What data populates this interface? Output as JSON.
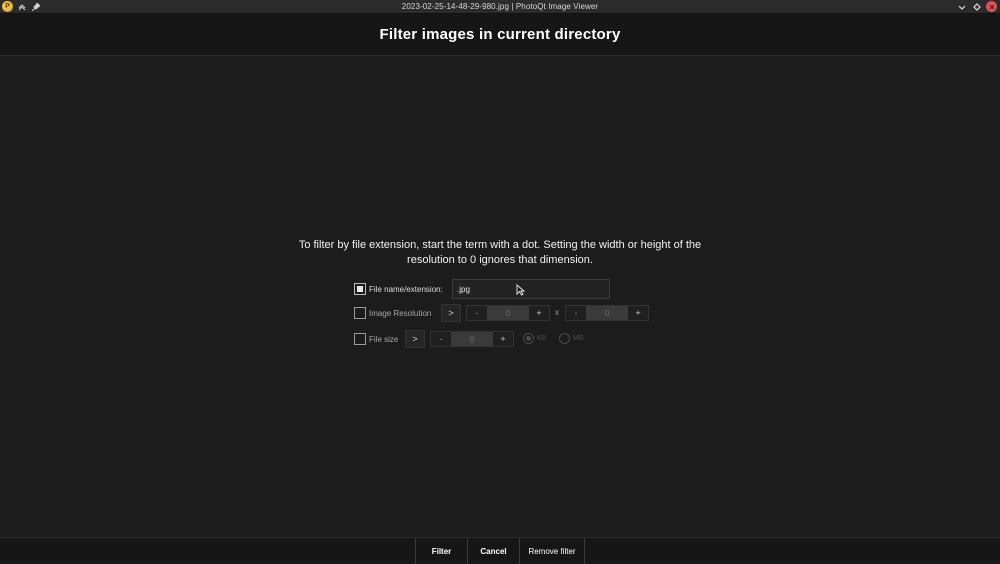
{
  "window": {
    "title": "2023-02-25-14-48-29-980.jpg | PhotoQt Image Viewer",
    "app_icon": "photoqt-app-icon"
  },
  "dialog": {
    "title": "Filter images in current directory",
    "info": "To filter by file extension, start the term with a dot. Setting the width or height of the resolution to 0 ignores that dimension.",
    "filename": {
      "checked": true,
      "label": "File name/extension:",
      "value": ".jpg"
    },
    "resolution": {
      "checked": false,
      "label": "Image Resolution",
      "comparator": ">",
      "width": "0",
      "height": "0",
      "separator": "x",
      "minus": "-",
      "plus": "+"
    },
    "filesize": {
      "checked": false,
      "label": "File size",
      "comparator": ">",
      "value": "0",
      "minus": "-",
      "plus": "+",
      "unit_kb": "KB",
      "unit_mb": "MB",
      "selected_unit": "KB"
    }
  },
  "buttons": {
    "filter": "Filter",
    "cancel": "Cancel",
    "remove_filter": "Remove filter"
  }
}
